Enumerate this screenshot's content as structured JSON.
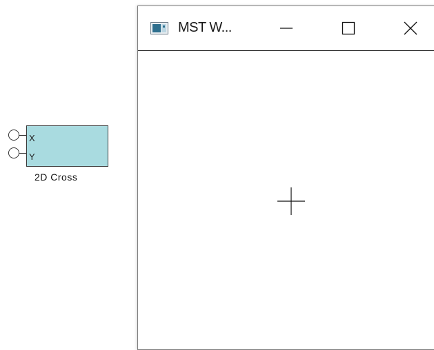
{
  "block": {
    "inputs": [
      {
        "label": "X"
      },
      {
        "label": "Y"
      }
    ],
    "name": "2D Cross",
    "fill_color": "#a9dbe0"
  },
  "window": {
    "title": "MST W...",
    "icon": "app-window-icon",
    "controls": {
      "minimize_icon": "minimize-icon",
      "maximize_icon": "maximize-icon",
      "close_icon": "close-icon"
    },
    "content": {
      "marker_icon": "crosshair-icon"
    }
  }
}
